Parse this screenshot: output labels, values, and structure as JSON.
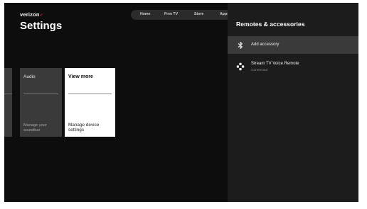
{
  "header": {
    "brand": "verizon",
    "brand_mark": "✓",
    "title": "Settings"
  },
  "topnav": {
    "items": [
      {
        "label": "Home"
      },
      {
        "label": "Free TV"
      },
      {
        "label": "Store"
      },
      {
        "label": "Apps"
      }
    ]
  },
  "cards": {
    "audio": {
      "title": "Audio",
      "description": "Manage your soundbar"
    },
    "view_more": {
      "title": "View more",
      "description": "Manage device settings"
    }
  },
  "panel": {
    "title": "Remotes & accessories",
    "items": [
      {
        "label": "Add accessory",
        "icon": "bluetooth-icon"
      },
      {
        "label": "Stream TV Voice Remote",
        "status": "Connected",
        "icon": "gamepad-icon"
      }
    ]
  },
  "colors": {
    "background": "#0d0d0d",
    "panel": "#1c1c1c",
    "selected_row": "#3a3a3a",
    "brand_red": "#e0262e",
    "focused_card": "#ffffff"
  }
}
